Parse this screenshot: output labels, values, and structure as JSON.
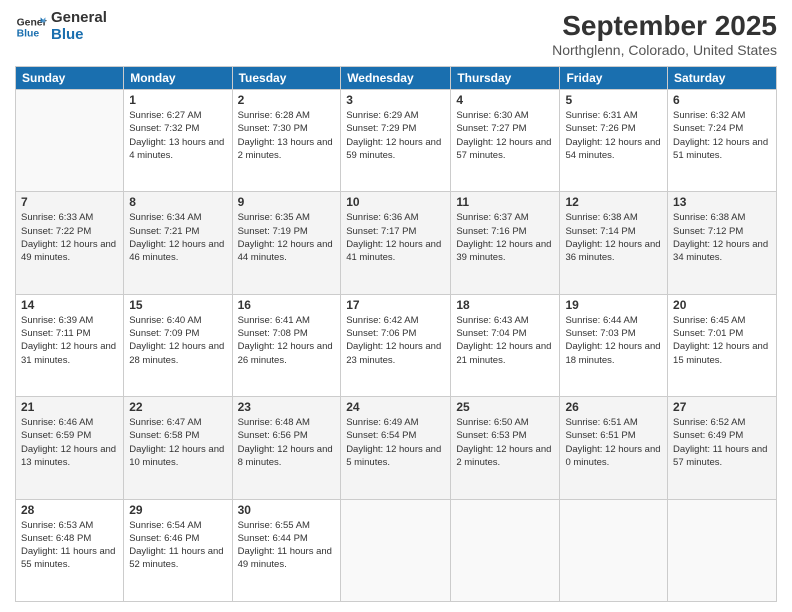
{
  "logo": {
    "line1": "General",
    "line2": "Blue"
  },
  "title": "September 2025",
  "location": "Northglenn, Colorado, United States",
  "weekdays": [
    "Sunday",
    "Monday",
    "Tuesday",
    "Wednesday",
    "Thursday",
    "Friday",
    "Saturday"
  ],
  "weeks": [
    [
      {
        "day": null
      },
      {
        "day": 1,
        "sunrise": "6:27 AM",
        "sunset": "7:32 PM",
        "daylight": "13 hours and 4 minutes."
      },
      {
        "day": 2,
        "sunrise": "6:28 AM",
        "sunset": "7:30 PM",
        "daylight": "13 hours and 2 minutes."
      },
      {
        "day": 3,
        "sunrise": "6:29 AM",
        "sunset": "7:29 PM",
        "daylight": "12 hours and 59 minutes."
      },
      {
        "day": 4,
        "sunrise": "6:30 AM",
        "sunset": "7:27 PM",
        "daylight": "12 hours and 57 minutes."
      },
      {
        "day": 5,
        "sunrise": "6:31 AM",
        "sunset": "7:26 PM",
        "daylight": "12 hours and 54 minutes."
      },
      {
        "day": 6,
        "sunrise": "6:32 AM",
        "sunset": "7:24 PM",
        "daylight": "12 hours and 51 minutes."
      }
    ],
    [
      {
        "day": 7,
        "sunrise": "6:33 AM",
        "sunset": "7:22 PM",
        "daylight": "12 hours and 49 minutes."
      },
      {
        "day": 8,
        "sunrise": "6:34 AM",
        "sunset": "7:21 PM",
        "daylight": "12 hours and 46 minutes."
      },
      {
        "day": 9,
        "sunrise": "6:35 AM",
        "sunset": "7:19 PM",
        "daylight": "12 hours and 44 minutes."
      },
      {
        "day": 10,
        "sunrise": "6:36 AM",
        "sunset": "7:17 PM",
        "daylight": "12 hours and 41 minutes."
      },
      {
        "day": 11,
        "sunrise": "6:37 AM",
        "sunset": "7:16 PM",
        "daylight": "12 hours and 39 minutes."
      },
      {
        "day": 12,
        "sunrise": "6:38 AM",
        "sunset": "7:14 PM",
        "daylight": "12 hours and 36 minutes."
      },
      {
        "day": 13,
        "sunrise": "6:38 AM",
        "sunset": "7:12 PM",
        "daylight": "12 hours and 34 minutes."
      }
    ],
    [
      {
        "day": 14,
        "sunrise": "6:39 AM",
        "sunset": "7:11 PM",
        "daylight": "12 hours and 31 minutes."
      },
      {
        "day": 15,
        "sunrise": "6:40 AM",
        "sunset": "7:09 PM",
        "daylight": "12 hours and 28 minutes."
      },
      {
        "day": 16,
        "sunrise": "6:41 AM",
        "sunset": "7:08 PM",
        "daylight": "12 hours and 26 minutes."
      },
      {
        "day": 17,
        "sunrise": "6:42 AM",
        "sunset": "7:06 PM",
        "daylight": "12 hours and 23 minutes."
      },
      {
        "day": 18,
        "sunrise": "6:43 AM",
        "sunset": "7:04 PM",
        "daylight": "12 hours and 21 minutes."
      },
      {
        "day": 19,
        "sunrise": "6:44 AM",
        "sunset": "7:03 PM",
        "daylight": "12 hours and 18 minutes."
      },
      {
        "day": 20,
        "sunrise": "6:45 AM",
        "sunset": "7:01 PM",
        "daylight": "12 hours and 15 minutes."
      }
    ],
    [
      {
        "day": 21,
        "sunrise": "6:46 AM",
        "sunset": "6:59 PM",
        "daylight": "12 hours and 13 minutes."
      },
      {
        "day": 22,
        "sunrise": "6:47 AM",
        "sunset": "6:58 PM",
        "daylight": "12 hours and 10 minutes."
      },
      {
        "day": 23,
        "sunrise": "6:48 AM",
        "sunset": "6:56 PM",
        "daylight": "12 hours and 8 minutes."
      },
      {
        "day": 24,
        "sunrise": "6:49 AM",
        "sunset": "6:54 PM",
        "daylight": "12 hours and 5 minutes."
      },
      {
        "day": 25,
        "sunrise": "6:50 AM",
        "sunset": "6:53 PM",
        "daylight": "12 hours and 2 minutes."
      },
      {
        "day": 26,
        "sunrise": "6:51 AM",
        "sunset": "6:51 PM",
        "daylight": "12 hours and 0 minutes."
      },
      {
        "day": 27,
        "sunrise": "6:52 AM",
        "sunset": "6:49 PM",
        "daylight": "11 hours and 57 minutes."
      }
    ],
    [
      {
        "day": 28,
        "sunrise": "6:53 AM",
        "sunset": "6:48 PM",
        "daylight": "11 hours and 55 minutes."
      },
      {
        "day": 29,
        "sunrise": "6:54 AM",
        "sunset": "6:46 PM",
        "daylight": "11 hours and 52 minutes."
      },
      {
        "day": 30,
        "sunrise": "6:55 AM",
        "sunset": "6:44 PM",
        "daylight": "11 hours and 49 minutes."
      },
      {
        "day": null
      },
      {
        "day": null
      },
      {
        "day": null
      },
      {
        "day": null
      }
    ]
  ]
}
